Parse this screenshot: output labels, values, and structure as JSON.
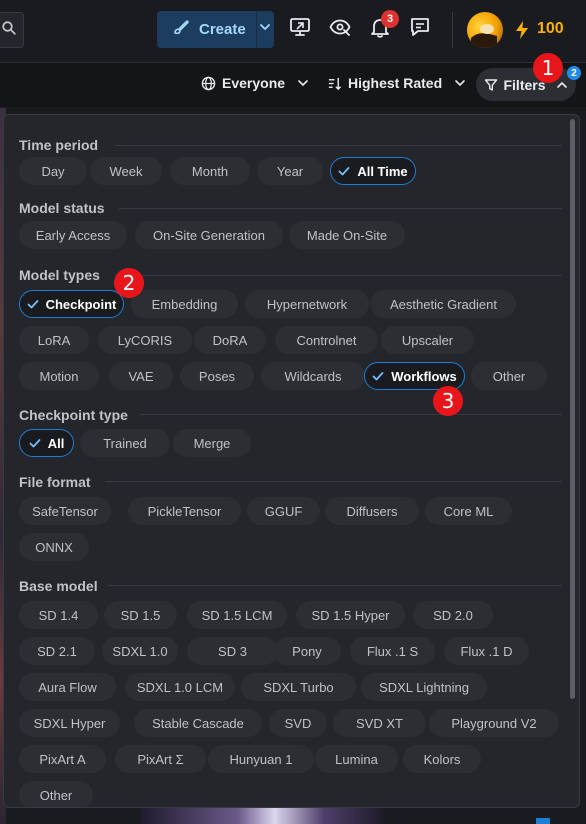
{
  "header": {
    "create_label": "Create",
    "notification_count": "3",
    "buzz_amount": "100",
    "icons": [
      "search-icon",
      "brush-icon",
      "chevron-down-icon",
      "monitor-upload-icon",
      "eye-off-icon",
      "bell-icon",
      "chat-icon",
      "bolt-icon"
    ]
  },
  "filterbar": {
    "audience_label": "Everyone",
    "sort_label": "Highest Rated",
    "filters_label": "Filters",
    "filters_count": "2"
  },
  "filters": {
    "time_period": {
      "title": "Time period",
      "options": [
        {
          "label": "Day",
          "selected": false
        },
        {
          "label": "Week",
          "selected": false
        },
        {
          "label": "Month",
          "selected": false
        },
        {
          "label": "Year",
          "selected": false
        },
        {
          "label": "All Time",
          "selected": true
        }
      ]
    },
    "model_status": {
      "title": "Model status",
      "options": [
        {
          "label": "Early Access",
          "selected": false
        },
        {
          "label": "On-Site Generation",
          "selected": false
        },
        {
          "label": "Made On-Site",
          "selected": false
        }
      ]
    },
    "model_types": {
      "title": "Model types",
      "options": [
        {
          "label": "Checkpoint",
          "selected": true
        },
        {
          "label": "Embedding",
          "selected": false
        },
        {
          "label": "Hypernetwork",
          "selected": false
        },
        {
          "label": "Aesthetic Gradient",
          "selected": false
        },
        {
          "label": "LoRA",
          "selected": false
        },
        {
          "label": "LyCORIS",
          "selected": false
        },
        {
          "label": "DoRA",
          "selected": false
        },
        {
          "label": "Controlnet",
          "selected": false
        },
        {
          "label": "Upscaler",
          "selected": false
        },
        {
          "label": "Motion",
          "selected": false
        },
        {
          "label": "VAE",
          "selected": false
        },
        {
          "label": "Poses",
          "selected": false
        },
        {
          "label": "Wildcards",
          "selected": false
        },
        {
          "label": "Workflows",
          "selected": true
        },
        {
          "label": "Other",
          "selected": false
        }
      ]
    },
    "checkpoint_type": {
      "title": "Checkpoint type",
      "options": [
        {
          "label": "All",
          "selected": true
        },
        {
          "label": "Trained",
          "selected": false
        },
        {
          "label": "Merge",
          "selected": false
        }
      ]
    },
    "file_format": {
      "title": "File format",
      "options": [
        {
          "label": "SafeTensor",
          "selected": false
        },
        {
          "label": "PickleTensor",
          "selected": false
        },
        {
          "label": "GGUF",
          "selected": false
        },
        {
          "label": "Diffusers",
          "selected": false
        },
        {
          "label": "Core ML",
          "selected": false
        },
        {
          "label": "ONNX",
          "selected": false
        }
      ]
    },
    "base_model": {
      "title": "Base model",
      "options": [
        {
          "label": "SD 1.4",
          "selected": false
        },
        {
          "label": "SD 1.5",
          "selected": false
        },
        {
          "label": "SD 1.5 LCM",
          "selected": false
        },
        {
          "label": "SD 1.5 Hyper",
          "selected": false
        },
        {
          "label": "SD 2.0",
          "selected": false
        },
        {
          "label": "SD 2.1",
          "selected": false
        },
        {
          "label": "SDXL 1.0",
          "selected": false
        },
        {
          "label": "SD 3",
          "selected": false
        },
        {
          "label": "Pony",
          "selected": false
        },
        {
          "label": "Flux .1 S",
          "selected": false
        },
        {
          "label": "Flux .1 D",
          "selected": false
        },
        {
          "label": "Aura Flow",
          "selected": false
        },
        {
          "label": "SDXL 1.0 LCM",
          "selected": false
        },
        {
          "label": "SDXL Turbo",
          "selected": false
        },
        {
          "label": "SDXL Lightning",
          "selected": false
        },
        {
          "label": "SDXL Hyper",
          "selected": false
        },
        {
          "label": "Stable Cascade",
          "selected": false
        },
        {
          "label": "SVD",
          "selected": false
        },
        {
          "label": "SVD XT",
          "selected": false
        },
        {
          "label": "Playground V2",
          "selected": false
        },
        {
          "label": "PixArt A",
          "selected": false
        },
        {
          "label": "PixArt Σ",
          "selected": false
        },
        {
          "label": "Hunyuan 1",
          "selected": false
        },
        {
          "label": "Lumina",
          "selected": false
        },
        {
          "label": "Kolors",
          "selected": false
        },
        {
          "label": "Other",
          "selected": false
        }
      ]
    }
  },
  "markers": [
    "1",
    "2",
    "3"
  ],
  "colors": {
    "accent": "#1c7ed6",
    "marker": "#e8161b",
    "buzz": "#fab005",
    "chip_bg": "#2c2e33",
    "panel_bg": "#25262b"
  }
}
